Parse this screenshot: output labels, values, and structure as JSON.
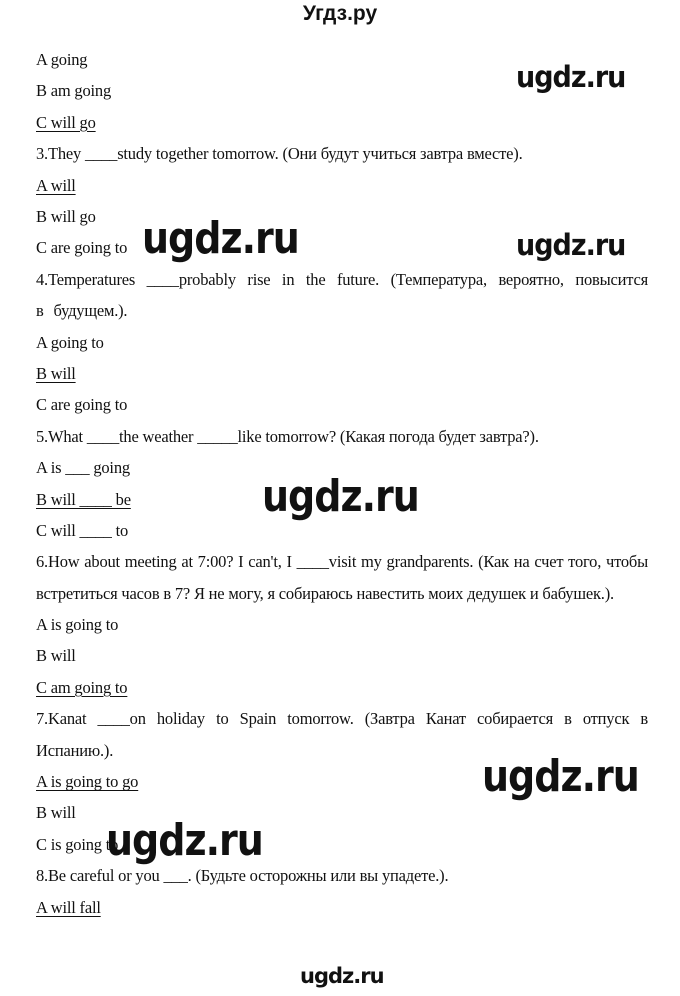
{
  "site_title": "Угдз.ру",
  "watermark": "ugdz.ru",
  "items": [
    {
      "type": "option",
      "text": "A going",
      "correct": false
    },
    {
      "type": "option",
      "text": "B am going",
      "correct": false
    },
    {
      "type": "option",
      "text": "C will go",
      "correct": true
    },
    {
      "type": "question",
      "text": "3.They ____study together tomorrow. (Они будут учиться завтра вместе)."
    },
    {
      "type": "option",
      "text": "A will",
      "correct": true
    },
    {
      "type": "option",
      "text": "B will go",
      "correct": false
    },
    {
      "type": "option",
      "text": "C are going to",
      "correct": false
    },
    {
      "type": "question",
      "text": "4.Temperatures ____probably rise in the future. (Температура, вероятно, повысится в будущем.)."
    },
    {
      "type": "option",
      "text": "A going to",
      "correct": false
    },
    {
      "type": "option",
      "text": "B will",
      "correct": true
    },
    {
      "type": "option",
      "text": "C are going to",
      "correct": false
    },
    {
      "type": "question",
      "text": "5.What ____the weather _____like tomorrow? (Какая погода будет завтра?)."
    },
    {
      "type": "option",
      "text": "A is ___ going",
      "correct": false
    },
    {
      "type": "option",
      "text": "B will ____ be",
      "correct": true
    },
    {
      "type": "option",
      "text": "C will ____ to",
      "correct": false
    },
    {
      "type": "question",
      "text": "6.How about meeting at 7:00? I can't, I ____visit my grandparents. (Как на счет того, чтобы встретиться часов в 7? Я не могу, я собираюсь навестить моих дедушек и бабушек.)."
    },
    {
      "type": "option",
      "text": "A is going to",
      "correct": false
    },
    {
      "type": "option",
      "text": "B will",
      "correct": false
    },
    {
      "type": "option",
      "text": "C am going to",
      "correct": true
    },
    {
      "type": "question",
      "text": "7.Kanat ____on holiday to Spain tomorrow. (Завтра Канат собирается в отпуск в Испанию.)."
    },
    {
      "type": "option",
      "text": "A is going to go",
      "correct": true
    },
    {
      "type": "option",
      "text": "B will",
      "correct": false
    },
    {
      "type": "option",
      "text": "C is going to",
      "correct": false
    },
    {
      "type": "question",
      "text": "8.Be careful or you ___. (Будьте осторожны или вы упадете.)."
    },
    {
      "type": "option",
      "text": "A will fall",
      "correct": true
    }
  ]
}
